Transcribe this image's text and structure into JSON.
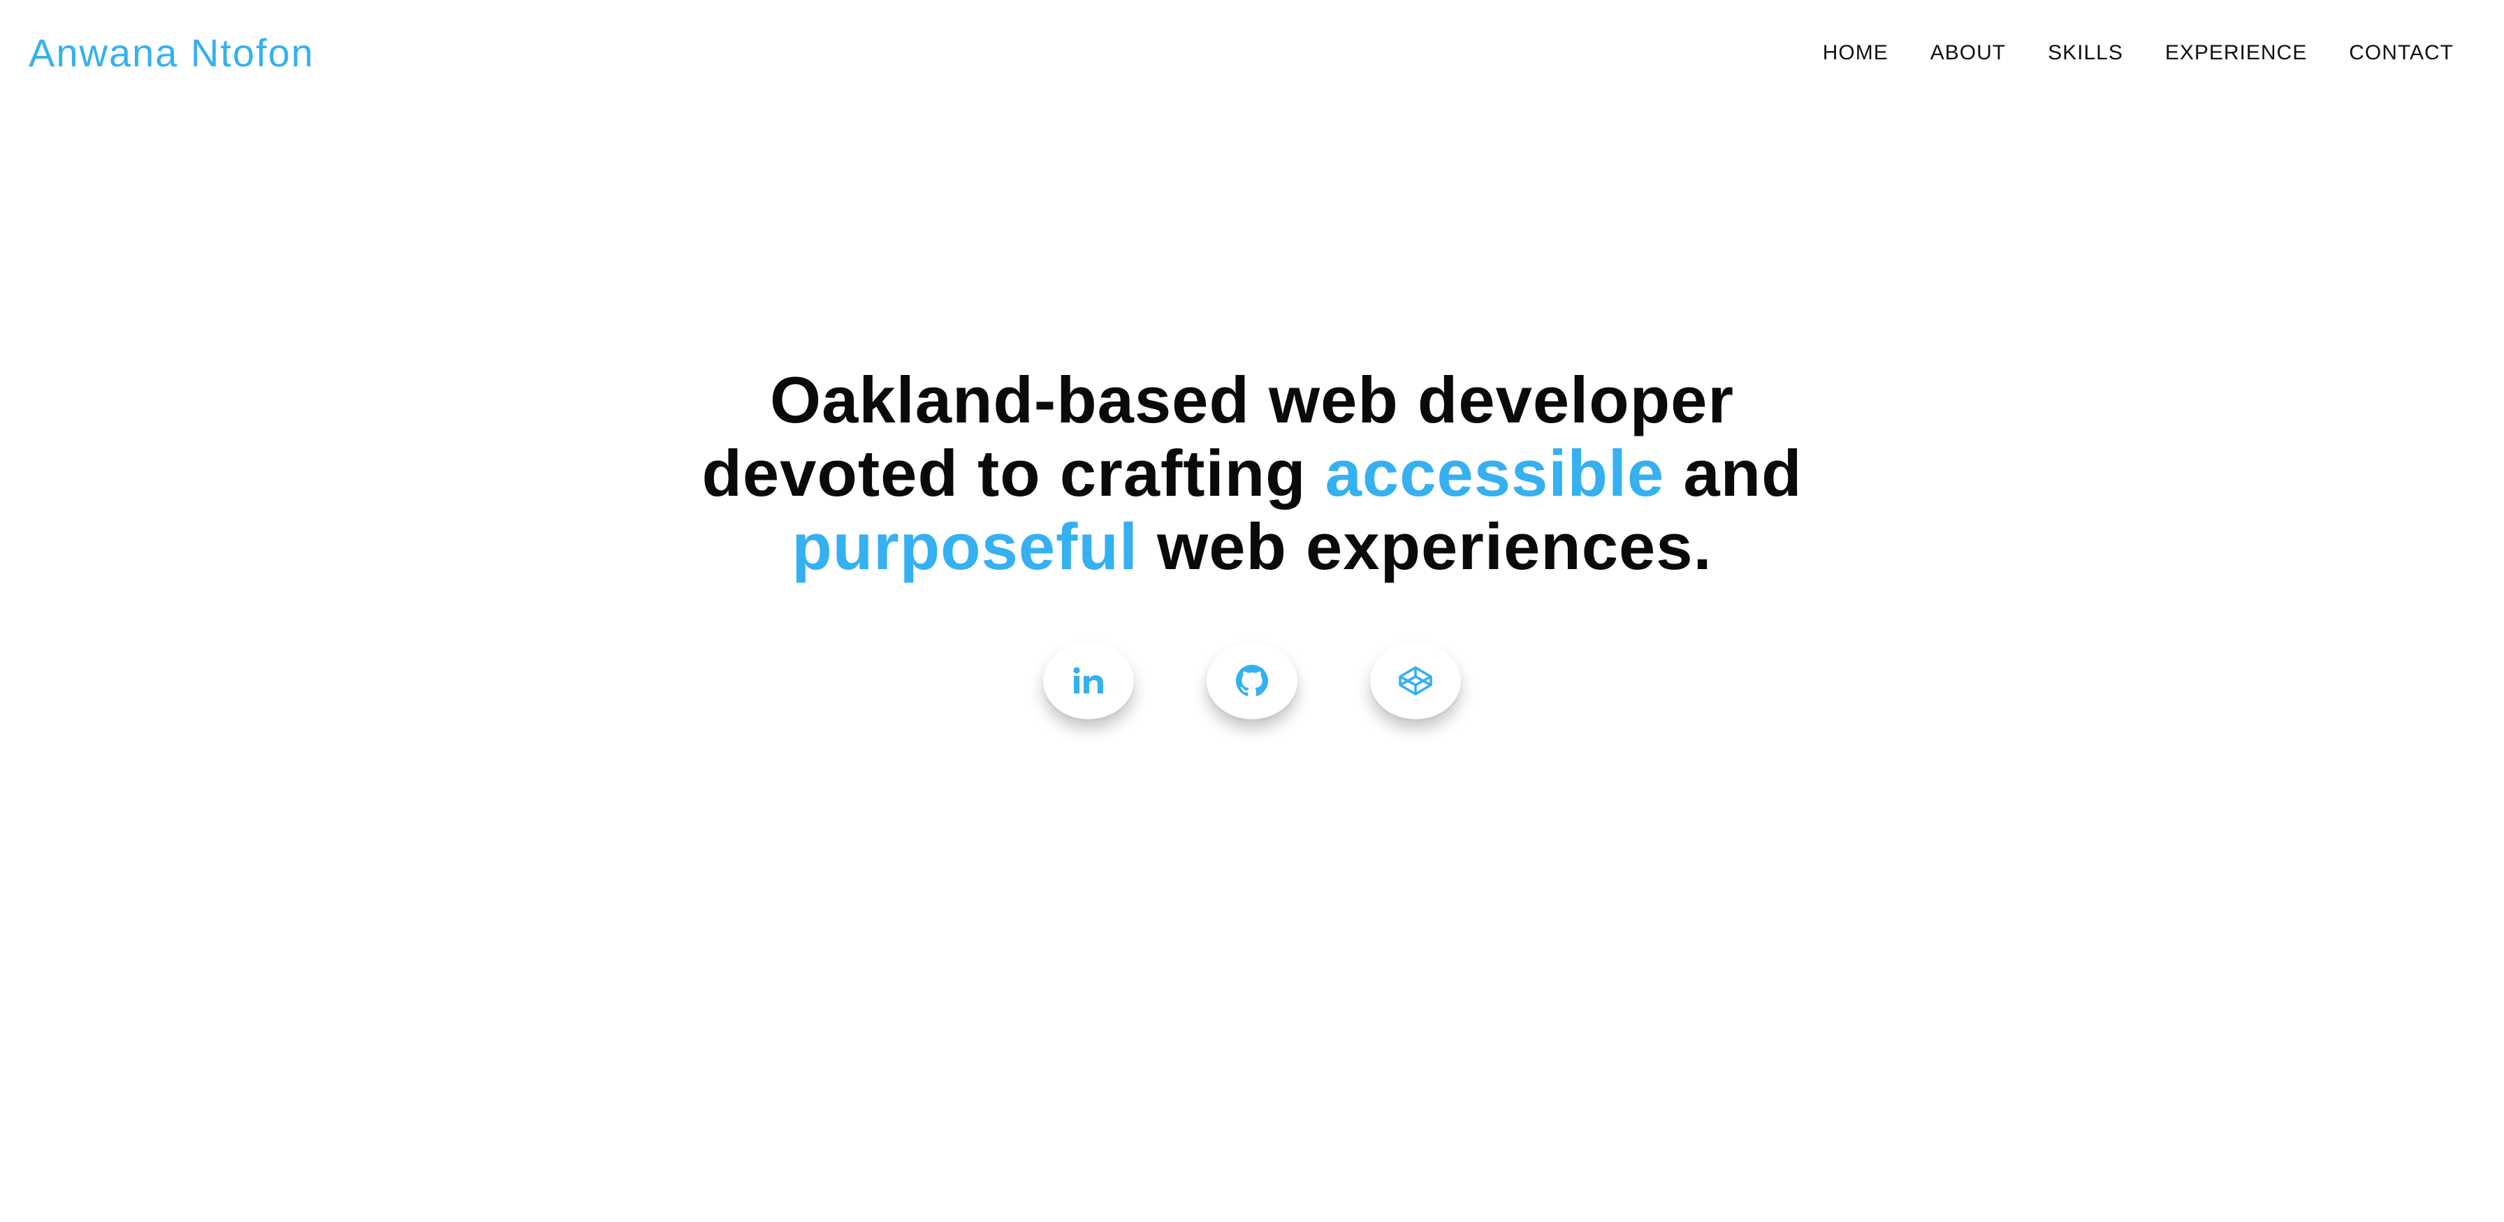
{
  "header": {
    "brand": "Anwana Ntofon",
    "nav": [
      {
        "label": "HOME"
      },
      {
        "label": "ABOUT"
      },
      {
        "label": "SKILLS"
      },
      {
        "label": "EXPERIENCE"
      },
      {
        "label": "CONTACT"
      }
    ]
  },
  "hero": {
    "line1": "Oakland-based web developer",
    "line2_pre": "devoted to crafting ",
    "accent1": "accessible",
    "line2_post": " and",
    "accent2": "purposeful",
    "line3_post": " web experiences."
  },
  "socials": [
    {
      "icon": "linkedin-icon"
    },
    {
      "icon": "github-icon"
    },
    {
      "icon": "codepen-icon"
    }
  ],
  "colors": {
    "accent": "#35b0f0",
    "text": "#0a0a0a",
    "background": "#ffffff"
  }
}
